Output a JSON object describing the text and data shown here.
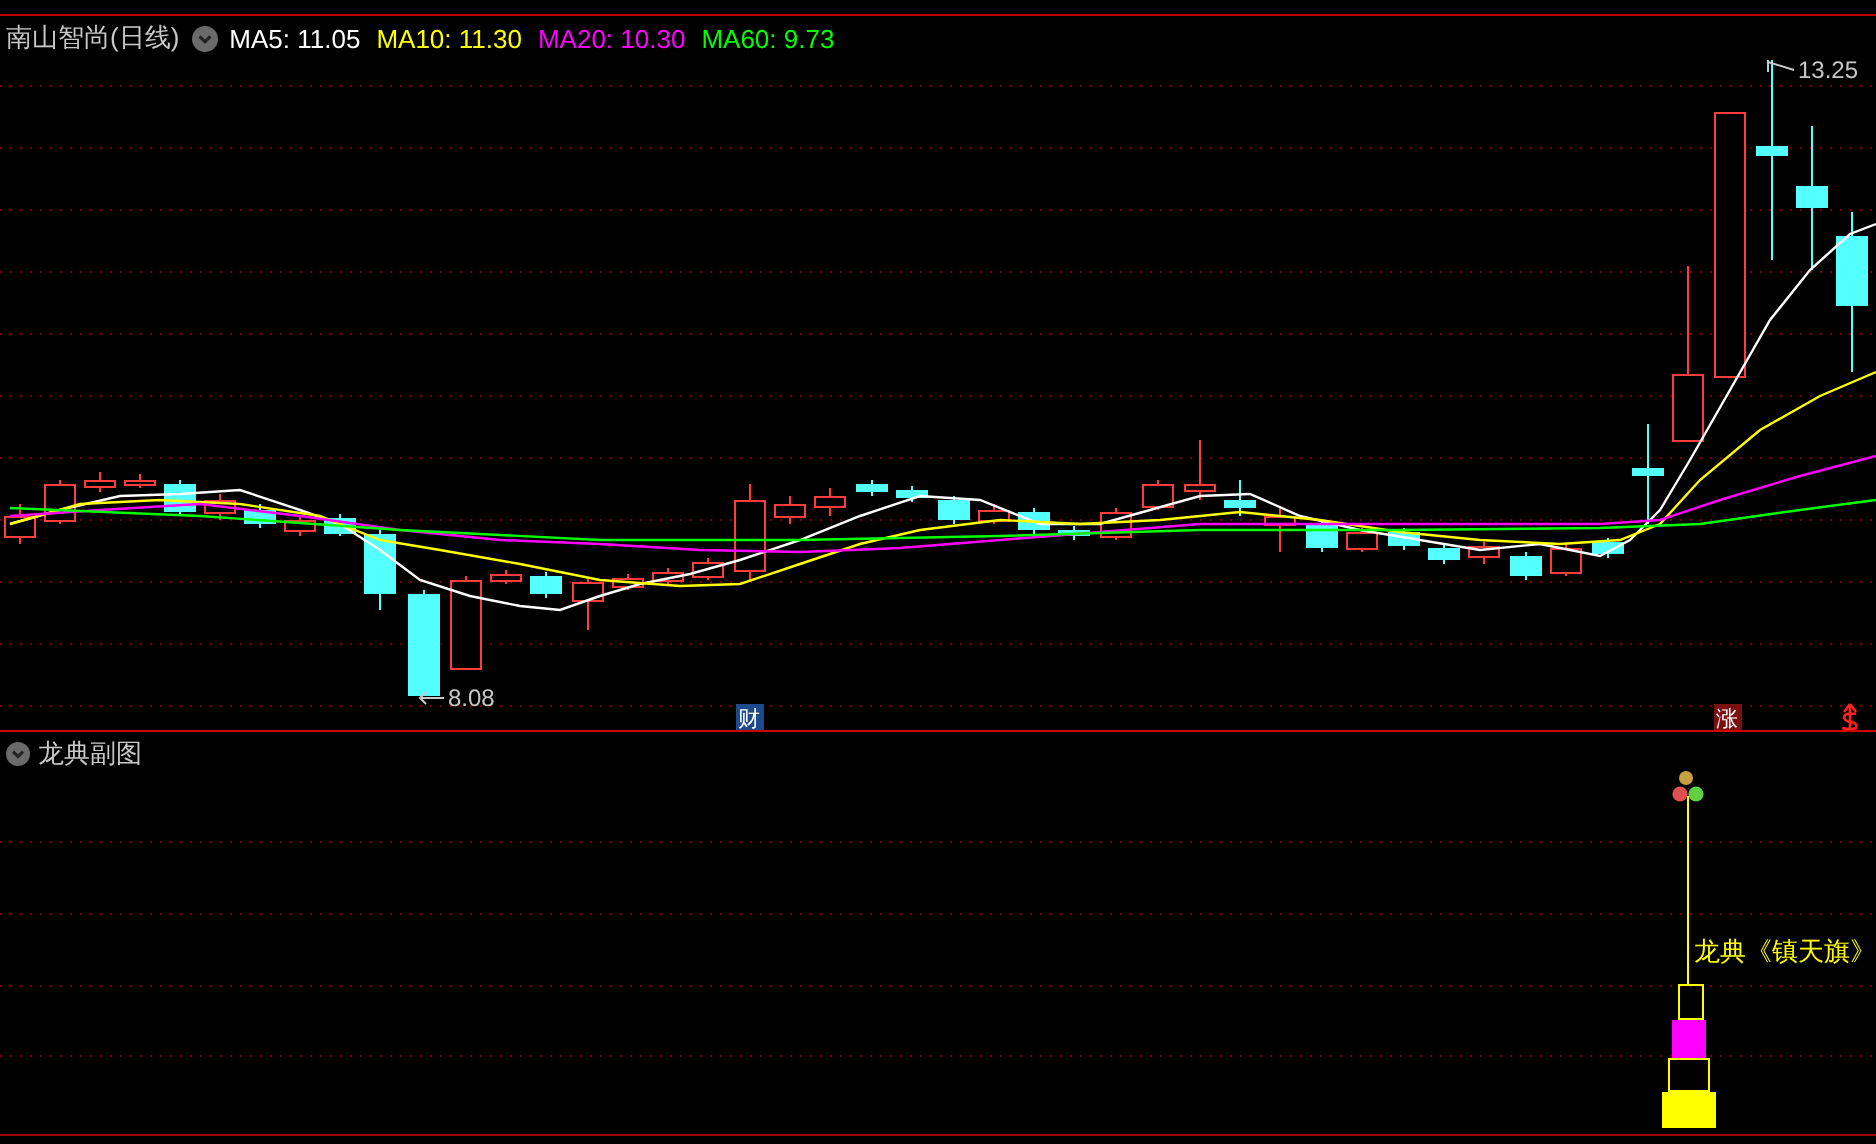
{
  "header": {
    "title": "南山智尚(日线)",
    "moving_averages": [
      {
        "label": "MA5: 11.05",
        "color": "#ffffff"
      },
      {
        "label": "MA10: 11.30",
        "color": "#ffff00"
      },
      {
        "label": "MA20: 10.30",
        "color": "#ff00ff"
      },
      {
        "label": "MA60: 9.73",
        "color": "#00ff00"
      }
    ]
  },
  "price_chart": {
    "high_label": "13.25",
    "low_label": "8.08",
    "markers": [
      {
        "label": "财",
        "kind": "finance"
      },
      {
        "label": "涨",
        "kind": "rise"
      }
    ]
  },
  "indicator": {
    "title": "龙典副图",
    "signal_label": "龙典《镇天旗》"
  }
}
